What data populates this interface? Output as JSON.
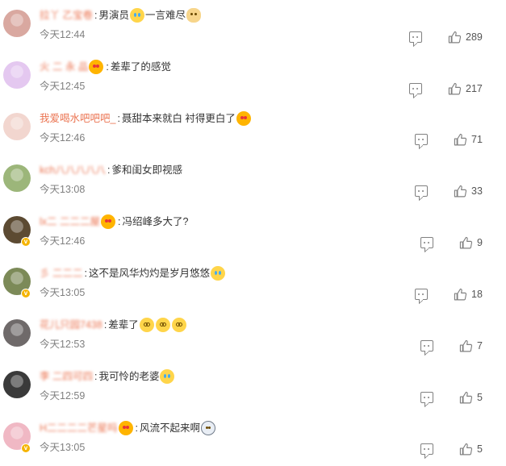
{
  "comments": [
    {
      "username": "拉丫 乙宝卷",
      "username_blurred": true,
      "text_before": "男演员",
      "emojis_after_text": [
        "cry"
      ],
      "text_after": "一言难尽",
      "trailing_emojis": [
        "cat"
      ],
      "time": "今天12:44",
      "likes": "289",
      "has_badge": false,
      "avatar_color": "#d9a8a0",
      "avatar_icon": "avatar-girl"
    },
    {
      "username": "火 二 永 品",
      "username_blurred": true,
      "pre_colon_emojis": [
        "love"
      ],
      "text_before": "差辈了的感觉",
      "time": "今天12:45",
      "likes": "217",
      "has_badge": false,
      "avatar_color": "#e4c8f0",
      "avatar_icon": "avatar-cartoon"
    },
    {
      "username": "我爱喝水吧吧吧_",
      "username_blurred": false,
      "text_before": "聂甜本来就白 衬得更白了",
      "trailing_emojis": [
        "love"
      ],
      "time": "今天12:46",
      "likes": "71",
      "has_badge": false,
      "avatar_color": "#f2d6cf",
      "avatar_icon": "avatar-girl"
    },
    {
      "username": "kch八八八八八",
      "username_blurred": true,
      "text_before": "爹和闺女即视感",
      "time": "今天13:08",
      "likes": "33",
      "has_badge": false,
      "avatar_color": "#9cb67a",
      "avatar_icon": "avatar-landscape"
    },
    {
      "username": "lx二 二二二屋",
      "username_blurred": true,
      "pre_colon_emojis": [
        "love"
      ],
      "text_before": "冯绍峰多大了?",
      "time": "今天12:46",
      "likes": "9",
      "has_badge": true,
      "avatar_color": "#5c4a32",
      "avatar_icon": "avatar-dark"
    },
    {
      "username": "彡 二二二",
      "username_blurred": true,
      "text_before": "这不是风华灼灼是岁月悠悠",
      "trailing_emojis": [
        "cry"
      ],
      "time": "今天13:05",
      "likes": "18",
      "has_badge": true,
      "avatar_color": "#7c8a58",
      "avatar_icon": "avatar-nature"
    },
    {
      "username": "花儿只园7438",
      "username_blurred": true,
      "text_before": "差辈了",
      "trailing_emojis": [
        "dizzy",
        "dizzy",
        "dizzy"
      ],
      "time": "今天12:53",
      "likes": "7",
      "has_badge": false,
      "avatar_color": "#6f6a6a",
      "avatar_icon": "avatar-cat"
    },
    {
      "username": "李 二四可四",
      "username_blurred": true,
      "text_before": "我可怜的老婆",
      "trailing_emojis": [
        "cry"
      ],
      "time": "今天12:59",
      "likes": "5",
      "has_badge": false,
      "avatar_color": "#3a3a3a",
      "avatar_icon": "avatar-dark"
    },
    {
      "username": "H二二二二芒星吗",
      "username_blurred": true,
      "pre_colon_emojis": [
        "love"
      ],
      "text_before": "风流不起来啊",
      "trailing_emojis": [
        "ghost"
      ],
      "time": "今天13:05",
      "likes": "5",
      "has_badge": true,
      "avatar_color": "#f0b8c4",
      "avatar_icon": "avatar-pink"
    }
  ],
  "colors": {
    "username": "#eb7350",
    "time": "#808080",
    "text": "#333333",
    "badge": "#f5b400"
  },
  "icons": {
    "reply": "comment-icon",
    "like": "thumbs-up-icon",
    "badge": "verified-badge-icon"
  }
}
